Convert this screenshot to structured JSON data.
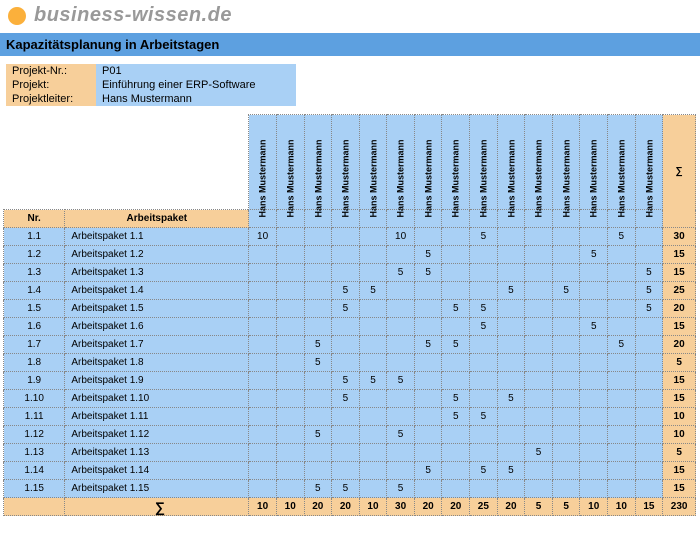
{
  "logo_text": "business-wissen.de",
  "title": "Kapazitätsplanung in Arbeitstagen",
  "meta": {
    "labels": {
      "proj_nr": "Projekt-Nr.:",
      "proj": "Projekt:",
      "lead": "Projektleiter:"
    },
    "values": {
      "proj_nr": "P01",
      "proj": "Einführung einer ERP-Software",
      "lead": "Hans Mustermann"
    }
  },
  "headers": {
    "nr": "Nr.",
    "ap": "Arbeitspaket",
    "sum": "∑"
  },
  "resources": [
    "Hans Mustermann",
    "Hans Mustermann",
    "Hans Mustermann",
    "Hans Mustermann",
    "Hans Mustermann",
    "Hans Mustermann",
    "Hans Mustermann",
    "Hans Mustermann",
    "Hans Mustermann",
    "Hans Mustermann",
    "Hans Mustermann",
    "Hans Mustermann",
    "Hans Mustermann",
    "Hans Mustermann",
    "Hans Mustermann"
  ],
  "rows": [
    {
      "nr": "1.1",
      "ap": "Arbeitspaket 1.1",
      "v": [
        "10",
        "",
        "",
        "",
        "",
        "10",
        "",
        "",
        "5",
        "",
        "",
        "",
        "",
        "5",
        ""
      ],
      "sum": "30"
    },
    {
      "nr": "1.2",
      "ap": "Arbeitspaket 1.2",
      "v": [
        "",
        "",
        "",
        "",
        "",
        "",
        "5",
        "",
        "",
        "",
        "",
        "",
        "5",
        "",
        ""
      ],
      "sum": "15"
    },
    {
      "nr": "1.3",
      "ap": "Arbeitspaket 1.3",
      "v": [
        "",
        "",
        "",
        "",
        "",
        "5",
        "5",
        "",
        "",
        "",
        "",
        "",
        "",
        "",
        "5"
      ],
      "sum": "15"
    },
    {
      "nr": "1.4",
      "ap": "Arbeitspaket 1.4",
      "v": [
        "",
        "",
        "",
        "5",
        "5",
        "",
        "",
        "",
        "",
        "5",
        "",
        "5",
        "",
        "",
        "5"
      ],
      "sum": "25"
    },
    {
      "nr": "1.5",
      "ap": "Arbeitspaket 1.5",
      "v": [
        "",
        "",
        "",
        "5",
        "",
        "",
        "",
        "5",
        "5",
        "",
        "",
        "",
        "",
        "",
        "5"
      ],
      "sum": "20"
    },
    {
      "nr": "1.6",
      "ap": "Arbeitspaket 1.6",
      "v": [
        "",
        "",
        "",
        "",
        "",
        "",
        "",
        "",
        "5",
        "",
        "",
        "",
        "5",
        "",
        ""
      ],
      "sum": "15"
    },
    {
      "nr": "1.7",
      "ap": "Arbeitspaket 1.7",
      "v": [
        "",
        "",
        "5",
        "",
        "",
        "",
        "5",
        "5",
        "",
        "",
        "",
        "",
        "",
        "5",
        ""
      ],
      "sum": "20"
    },
    {
      "nr": "1.8",
      "ap": "Arbeitspaket 1.8",
      "v": [
        "",
        "",
        "5",
        "",
        "",
        "",
        "",
        "",
        "",
        "",
        "",
        "",
        "",
        "",
        ""
      ],
      "sum": "5"
    },
    {
      "nr": "1.9",
      "ap": "Arbeitspaket 1.9",
      "v": [
        "",
        "",
        "",
        "5",
        "5",
        "5",
        "",
        "",
        "",
        "",
        "",
        "",
        "",
        "",
        ""
      ],
      "sum": "15"
    },
    {
      "nr": "1.10",
      "ap": "Arbeitspaket 1.10",
      "v": [
        "",
        "",
        "",
        "5",
        "",
        "",
        "",
        "5",
        "",
        "5",
        "",
        "",
        "",
        "",
        ""
      ],
      "sum": "15"
    },
    {
      "nr": "1.11",
      "ap": "Arbeitspaket 1.11",
      "v": [
        "",
        "",
        "",
        "",
        "",
        "",
        "",
        "5",
        "5",
        "",
        "",
        "",
        "",
        "",
        ""
      ],
      "sum": "10"
    },
    {
      "nr": "1.12",
      "ap": "Arbeitspaket 1.12",
      "v": [
        "",
        "",
        "5",
        "",
        "",
        "5",
        "",
        "",
        "",
        "",
        "",
        "",
        "",
        "",
        ""
      ],
      "sum": "10"
    },
    {
      "nr": "1.13",
      "ap": "Arbeitspaket 1.13",
      "v": [
        "",
        "",
        "",
        "",
        "",
        "",
        "",
        "",
        "",
        "",
        "5",
        "",
        "",
        "",
        ""
      ],
      "sum": "5"
    },
    {
      "nr": "1.14",
      "ap": "Arbeitspaket 1.14",
      "v": [
        "",
        "",
        "",
        "",
        "",
        "",
        "5",
        "",
        "5",
        "5",
        "",
        "",
        "",
        "",
        ""
      ],
      "sum": "15"
    },
    {
      "nr": "1.15",
      "ap": "Arbeitspaket 1.15",
      "v": [
        "",
        "",
        "5",
        "5",
        "",
        "5",
        "",
        "",
        "",
        "",
        "",
        "",
        "",
        "",
        ""
      ],
      "sum": "15"
    }
  ],
  "totals": {
    "sigma": "∑",
    "v": [
      "10",
      "10",
      "20",
      "20",
      "10",
      "30",
      "20",
      "20",
      "25",
      "20",
      "5",
      "5",
      "10",
      "10",
      "15"
    ],
    "sum": "230"
  }
}
